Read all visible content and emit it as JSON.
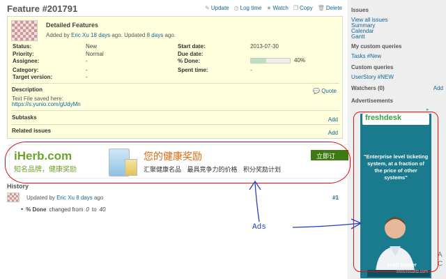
{
  "issue": {
    "title": "Feature #201791",
    "subject": "Detailed Features",
    "author_line": {
      "prefix": "Added by",
      "author": "Eric Xu",
      "age": "18 days",
      "mid": "ago. Updated",
      "updated": "8 days",
      "suffix": "ago."
    },
    "attributes": {
      "status_label": "Status:",
      "status": "New",
      "priority_label": "Priority:",
      "priority": "Normal",
      "assignee_label": "Assignee:",
      "assignee": "-",
      "category_label": "Category:",
      "category": "-",
      "target_label": "Target version:",
      "target": "-",
      "start_label": "Start date:",
      "start": "2013-07-30",
      "due_label": "Due date:",
      "due": "",
      "done_label": "% Done:",
      "done": "40%",
      "done_fraction": 0.4,
      "spent_label": "Spent time:",
      "spent": "-"
    },
    "description_title": "Description",
    "quote": "Quote",
    "description_text": "Text File saved here:",
    "description_link": "https://s.yunio.com/gUdyMn",
    "subtasks": "Subtasks",
    "related": "Related issues",
    "add": "Add"
  },
  "actions": [
    {
      "icon": "pencil-icon",
      "glyph": "✎",
      "label": "Update"
    },
    {
      "icon": "clock-icon",
      "glyph": "◷",
      "label": "Log time"
    },
    {
      "icon": "star-icon",
      "glyph": "★",
      "label": "Watch"
    },
    {
      "icon": "copy-icon",
      "glyph": "❐",
      "label": "Copy"
    },
    {
      "icon": "trash-icon",
      "glyph": "🗑",
      "label": "Delete"
    }
  ],
  "banner_ad": {
    "logo": "iHerb.com",
    "logo_sub": "知名品牌，健康奖励",
    "headline": "您的健康奖励",
    "tagline": "汇聚健康名品 最具竞争力的价格 积分奖励计划",
    "button": "立即订"
  },
  "annotation_label": "Ads",
  "history": {
    "title": "History",
    "updated_by": "Updated by",
    "author": "Eric Xu",
    "age": "8 days",
    "ago": "ago",
    "number": "#1",
    "field": "% Done",
    "changed": "changed from",
    "from": "0",
    "to_word": "to",
    "to": "40"
  },
  "sidebar": {
    "issues_title": "Issues",
    "issue_links": [
      "View all issues",
      "Summary",
      "Calendar",
      "Gantt"
    ],
    "custom_title": "My custom queries",
    "custom_links": [
      "Tasks #New"
    ],
    "custom2_title": "Custom queries",
    "custom2_links": [
      "UserStory #NEW"
    ],
    "watchers": "Watchers (0)",
    "watchers_add": "Add",
    "ads_title": "Advertisements"
  },
  "sky_ad": {
    "brand": "freshdesk",
    "text": "\"Enterprise level ticketing system, at a fraction of the price of other systems\"",
    "person_name": "Scott Bowler",
    "site": "www.localiiz.com",
    "cut1": "A",
    "cut2": "C"
  },
  "colors": {
    "link": "#116699",
    "issue_bg": "#ffffdd",
    "annotation_red": "#e01010",
    "annotation_blue": "#2040c0",
    "sidebar_bg": "#eeeeee"
  }
}
